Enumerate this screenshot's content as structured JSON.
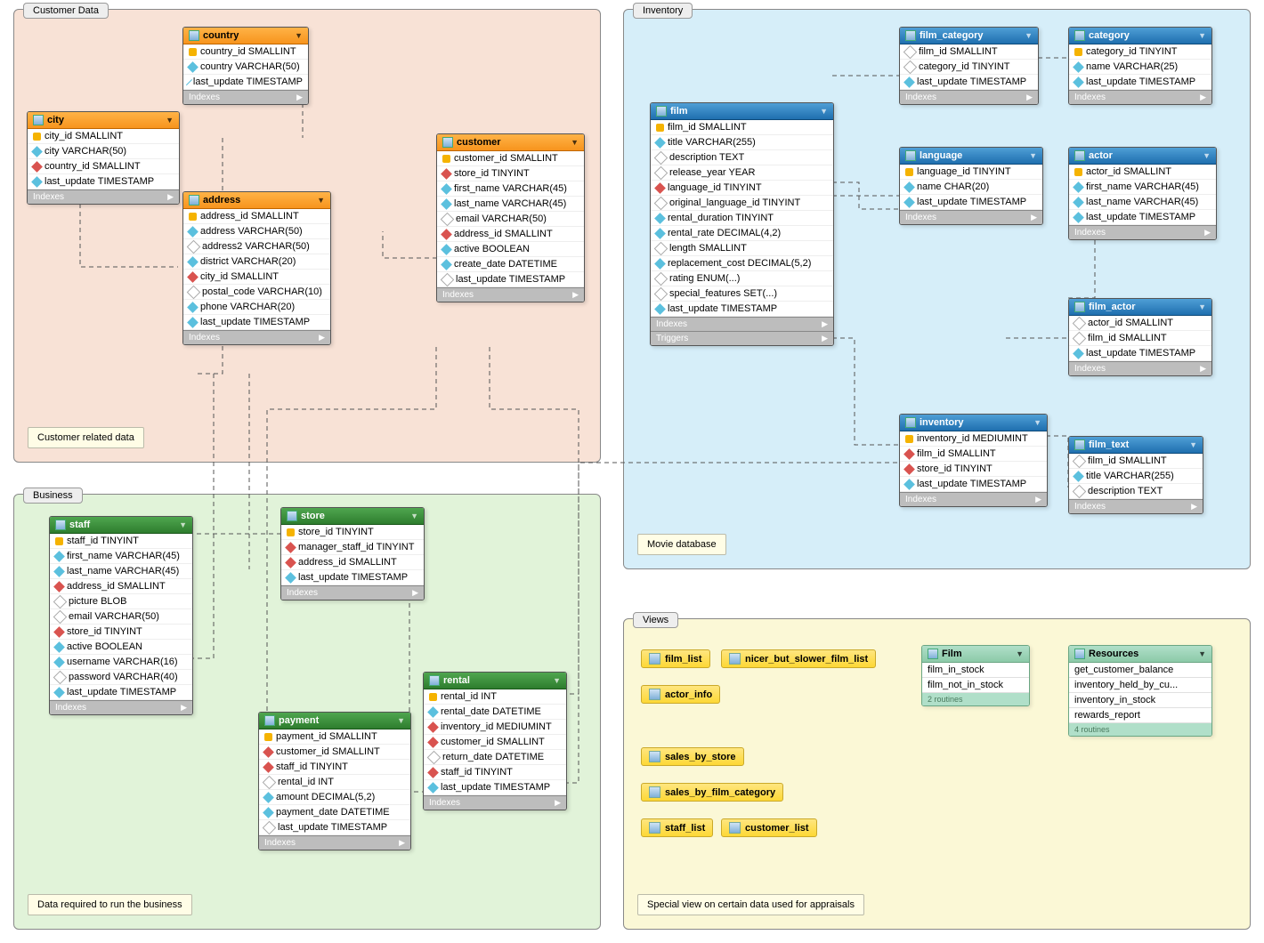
{
  "regions": {
    "customer": {
      "label": "Customer Data",
      "note": "Customer related data"
    },
    "business": {
      "label": "Business",
      "note": "Data required to run the business"
    },
    "inventory": {
      "label": "Inventory",
      "note": "Movie database"
    },
    "views": {
      "label": "Views",
      "note": "Special view on certain data used for appraisals"
    }
  },
  "tables": {
    "country": {
      "name": "country",
      "cols": [
        {
          "g": "pk",
          "n": "country_id SMALLINT"
        },
        {
          "g": "idx",
          "n": "country VARCHAR(50)"
        },
        {
          "g": "idx",
          "n": "last_update TIMESTAMP"
        }
      ],
      "sections": [
        "Indexes"
      ]
    },
    "city": {
      "name": "city",
      "cols": [
        {
          "g": "pk",
          "n": "city_id SMALLINT"
        },
        {
          "g": "idx",
          "n": "city VARCHAR(50)"
        },
        {
          "g": "fk",
          "n": "country_id SMALLINT"
        },
        {
          "g": "idx",
          "n": "last_update TIMESTAMP"
        }
      ],
      "sections": [
        "Indexes"
      ]
    },
    "address": {
      "name": "address",
      "cols": [
        {
          "g": "pk",
          "n": "address_id SMALLINT"
        },
        {
          "g": "idx",
          "n": "address VARCHAR(50)"
        },
        {
          "g": "col",
          "n": "address2 VARCHAR(50)"
        },
        {
          "g": "idx",
          "n": "district VARCHAR(20)"
        },
        {
          "g": "fk",
          "n": "city_id SMALLINT"
        },
        {
          "g": "col",
          "n": "postal_code VARCHAR(10)"
        },
        {
          "g": "idx",
          "n": "phone VARCHAR(20)"
        },
        {
          "g": "idx",
          "n": "last_update TIMESTAMP"
        }
      ],
      "sections": [
        "Indexes"
      ]
    },
    "customer": {
      "name": "customer",
      "cols": [
        {
          "g": "pk",
          "n": "customer_id SMALLINT"
        },
        {
          "g": "fk",
          "n": "store_id TINYINT"
        },
        {
          "g": "idx",
          "n": "first_name VARCHAR(45)"
        },
        {
          "g": "idx",
          "n": "last_name VARCHAR(45)"
        },
        {
          "g": "col",
          "n": "email VARCHAR(50)"
        },
        {
          "g": "fk",
          "n": "address_id SMALLINT"
        },
        {
          "g": "idx",
          "n": "active BOOLEAN"
        },
        {
          "g": "idx",
          "n": "create_date DATETIME"
        },
        {
          "g": "col",
          "n": "last_update TIMESTAMP"
        }
      ],
      "sections": [
        "Indexes"
      ]
    },
    "staff": {
      "name": "staff",
      "cols": [
        {
          "g": "pk",
          "n": "staff_id TINYINT"
        },
        {
          "g": "idx",
          "n": "first_name VARCHAR(45)"
        },
        {
          "g": "idx",
          "n": "last_name VARCHAR(45)"
        },
        {
          "g": "fk",
          "n": "address_id SMALLINT"
        },
        {
          "g": "col",
          "n": "picture BLOB"
        },
        {
          "g": "col",
          "n": "email VARCHAR(50)"
        },
        {
          "g": "fk",
          "n": "store_id TINYINT"
        },
        {
          "g": "idx",
          "n": "active BOOLEAN"
        },
        {
          "g": "idx",
          "n": "username VARCHAR(16)"
        },
        {
          "g": "col",
          "n": "password VARCHAR(40)"
        },
        {
          "g": "idx",
          "n": "last_update TIMESTAMP"
        }
      ],
      "sections": [
        "Indexes"
      ]
    },
    "store": {
      "name": "store",
      "cols": [
        {
          "g": "pk",
          "n": "store_id TINYINT"
        },
        {
          "g": "fk",
          "n": "manager_staff_id TINYINT"
        },
        {
          "g": "fk",
          "n": "address_id SMALLINT"
        },
        {
          "g": "idx",
          "n": "last_update TIMESTAMP"
        }
      ],
      "sections": [
        "Indexes"
      ]
    },
    "payment": {
      "name": "payment",
      "cols": [
        {
          "g": "pk",
          "n": "payment_id SMALLINT"
        },
        {
          "g": "fk",
          "n": "customer_id SMALLINT"
        },
        {
          "g": "fk",
          "n": "staff_id TINYINT"
        },
        {
          "g": "col",
          "n": "rental_id INT"
        },
        {
          "g": "idx",
          "n": "amount DECIMAL(5,2)"
        },
        {
          "g": "idx",
          "n": "payment_date DATETIME"
        },
        {
          "g": "col",
          "n": "last_update TIMESTAMP"
        }
      ],
      "sections": [
        "Indexes"
      ]
    },
    "rental": {
      "name": "rental",
      "cols": [
        {
          "g": "pk",
          "n": "rental_id INT"
        },
        {
          "g": "idx",
          "n": "rental_date DATETIME"
        },
        {
          "g": "fk",
          "n": "inventory_id MEDIUMINT"
        },
        {
          "g": "fk",
          "n": "customer_id SMALLINT"
        },
        {
          "g": "col",
          "n": "return_date DATETIME"
        },
        {
          "g": "fk",
          "n": "staff_id TINYINT"
        },
        {
          "g": "idx",
          "n": "last_update TIMESTAMP"
        }
      ],
      "sections": [
        "Indexes"
      ]
    },
    "film": {
      "name": "film",
      "cols": [
        {
          "g": "pk",
          "n": "film_id SMALLINT"
        },
        {
          "g": "idx",
          "n": "title VARCHAR(255)"
        },
        {
          "g": "col",
          "n": "description TEXT"
        },
        {
          "g": "col",
          "n": "release_year YEAR"
        },
        {
          "g": "fk",
          "n": "language_id TINYINT"
        },
        {
          "g": "col",
          "n": "original_language_id TINYINT"
        },
        {
          "g": "idx",
          "n": "rental_duration TINYINT"
        },
        {
          "g": "idx",
          "n": "rental_rate DECIMAL(4,2)"
        },
        {
          "g": "col",
          "n": "length SMALLINT"
        },
        {
          "g": "idx",
          "n": "replacement_cost DECIMAL(5,2)"
        },
        {
          "g": "col",
          "n": "rating ENUM(...)"
        },
        {
          "g": "col",
          "n": "special_features SET(...)"
        },
        {
          "g": "idx",
          "n": "last_update TIMESTAMP"
        }
      ],
      "sections": [
        "Indexes",
        "Triggers"
      ]
    },
    "film_category": {
      "name": "film_category",
      "cols": [
        {
          "g": "col",
          "n": "film_id SMALLINT"
        },
        {
          "g": "col",
          "n": "category_id TINYINT"
        },
        {
          "g": "idx",
          "n": "last_update TIMESTAMP"
        }
      ],
      "sections": [
        "Indexes"
      ]
    },
    "category": {
      "name": "category",
      "cols": [
        {
          "g": "pk",
          "n": "category_id TINYINT"
        },
        {
          "g": "idx",
          "n": "name VARCHAR(25)"
        },
        {
          "g": "idx",
          "n": "last_update TIMESTAMP"
        }
      ],
      "sections": [
        "Indexes"
      ]
    },
    "language": {
      "name": "language",
      "cols": [
        {
          "g": "pk",
          "n": "language_id TINYINT"
        },
        {
          "g": "idx",
          "n": "name CHAR(20)"
        },
        {
          "g": "idx",
          "n": "last_update TIMESTAMP"
        }
      ],
      "sections": [
        "Indexes"
      ]
    },
    "actor": {
      "name": "actor",
      "cols": [
        {
          "g": "pk",
          "n": "actor_id SMALLINT"
        },
        {
          "g": "idx",
          "n": "first_name VARCHAR(45)"
        },
        {
          "g": "idx",
          "n": "last_name VARCHAR(45)"
        },
        {
          "g": "idx",
          "n": "last_update TIMESTAMP"
        }
      ],
      "sections": [
        "Indexes"
      ]
    },
    "film_actor": {
      "name": "film_actor",
      "cols": [
        {
          "g": "col",
          "n": "actor_id SMALLINT"
        },
        {
          "g": "col",
          "n": "film_id SMALLINT"
        },
        {
          "g": "idx",
          "n": "last_update TIMESTAMP"
        }
      ],
      "sections": [
        "Indexes"
      ]
    },
    "inventory": {
      "name": "inventory",
      "cols": [
        {
          "g": "pk",
          "n": "inventory_id MEDIUMINT"
        },
        {
          "g": "fk",
          "n": "film_id SMALLINT"
        },
        {
          "g": "fk",
          "n": "store_id TINYINT"
        },
        {
          "g": "idx",
          "n": "last_update TIMESTAMP"
        }
      ],
      "sections": [
        "Indexes"
      ]
    },
    "film_text": {
      "name": "film_text",
      "cols": [
        {
          "g": "col",
          "n": "film_id SMALLINT"
        },
        {
          "g": "idx",
          "n": "title VARCHAR(255)"
        },
        {
          "g": "col",
          "n": "description TEXT"
        }
      ],
      "sections": [
        "Indexes"
      ]
    }
  },
  "views": {
    "chips": [
      "film_list",
      "nicer_but_slower_film_list",
      "actor_info",
      "sales_by_store",
      "sales_by_film_category",
      "staff_list",
      "customer_list"
    ],
    "routine_boxes": {
      "film": {
        "title": "Film",
        "items": [
          "film_in_stock",
          "film_not_in_stock"
        ],
        "footer": "2 routines"
      },
      "resources": {
        "title": "Resources",
        "items": [
          "get_customer_balance",
          "inventory_held_by_cu...",
          "inventory_in_stock",
          "rewards_report"
        ],
        "footer": "4 routines"
      }
    }
  }
}
